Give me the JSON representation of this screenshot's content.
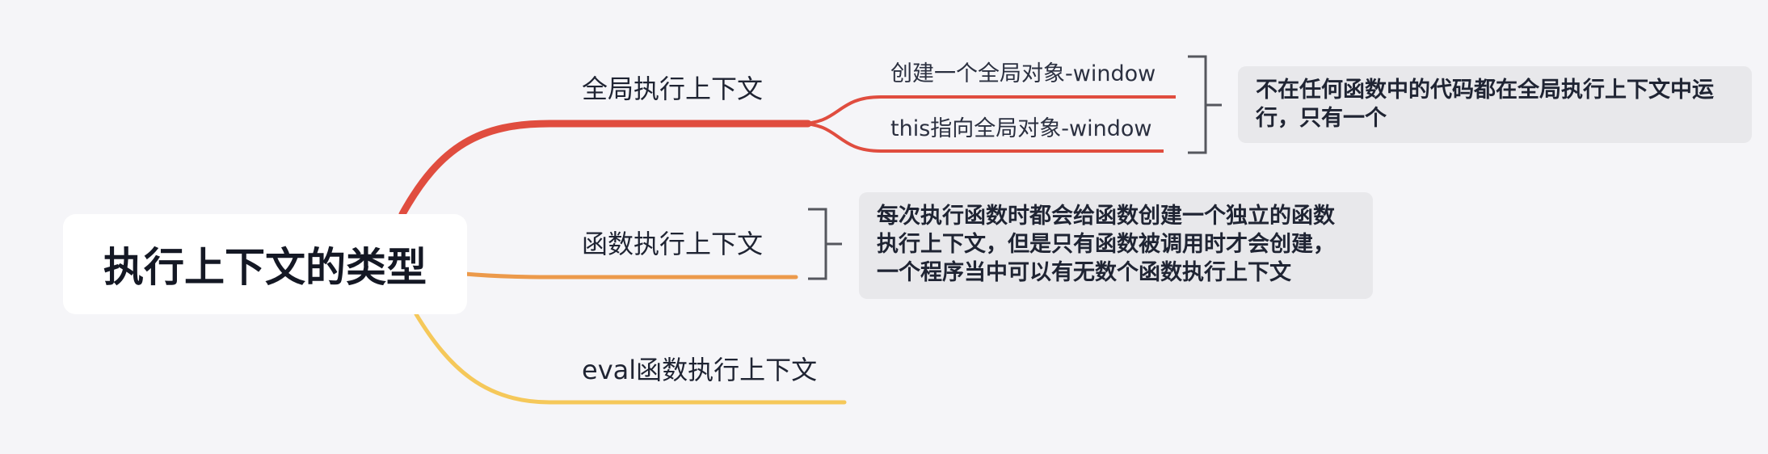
{
  "diagram": {
    "root": "执行上下文的类型",
    "branches": [
      {
        "label": "全局执行上下文",
        "color": "#e04d3f",
        "children": [
          "创建一个全局对象-window",
          "this指向全局对象-window"
        ],
        "note": "不在任何函数中的代码都在全局执行上下文中运行，只有一个"
      },
      {
        "label": "函数执行上下文",
        "color": "#ec9a4b",
        "note": "每次执行函数时都会给函数创建一个独立的函数执行上下文，但是只有函数被调用时才会创建，一个程序当中可以有无数个函数执行上下文"
      },
      {
        "label": "eval函数执行上下文",
        "color": "#f5c85a"
      }
    ],
    "bracket_color": "#55575e"
  }
}
